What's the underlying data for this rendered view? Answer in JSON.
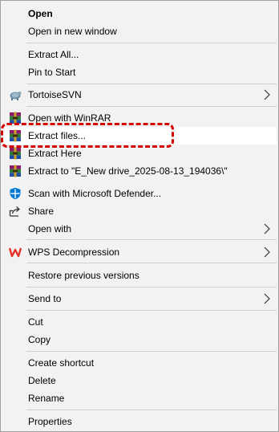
{
  "menu": {
    "open": "Open",
    "open_new_window": "Open in new window",
    "extract_all": "Extract All...",
    "pin_to_start": "Pin to Start",
    "tortoisesvn": "TortoiseSVN",
    "open_with_winrar": "Open with WinRAR",
    "extract_files": "Extract files...",
    "extract_here": "Extract Here",
    "extract_to": "Extract to \"E_New drive_2025-08-13_194036\\\"",
    "scan_defender": "Scan with Microsoft Defender...",
    "share": "Share",
    "open_with": "Open with",
    "wps_decompression": "WPS Decompression",
    "restore_previous": "Restore previous versions",
    "send_to": "Send to",
    "cut": "Cut",
    "copy": "Copy",
    "create_shortcut": "Create shortcut",
    "delete": "Delete",
    "rename": "Rename",
    "properties": "Properties"
  },
  "icons": {
    "tortoisesvn": "tortoisesvn-icon",
    "winrar": "winrar-icon",
    "defender": "defender-shield-icon",
    "share": "share-icon",
    "wps": "wps-icon",
    "submenu": "chevron-right-icon"
  },
  "colors": {
    "menu_bg": "#f2f2f2",
    "hover_bg": "#ffffff",
    "highlight_border": "#d40000",
    "defender_blue": "#0078d4",
    "wps_red": "#e8312b"
  }
}
